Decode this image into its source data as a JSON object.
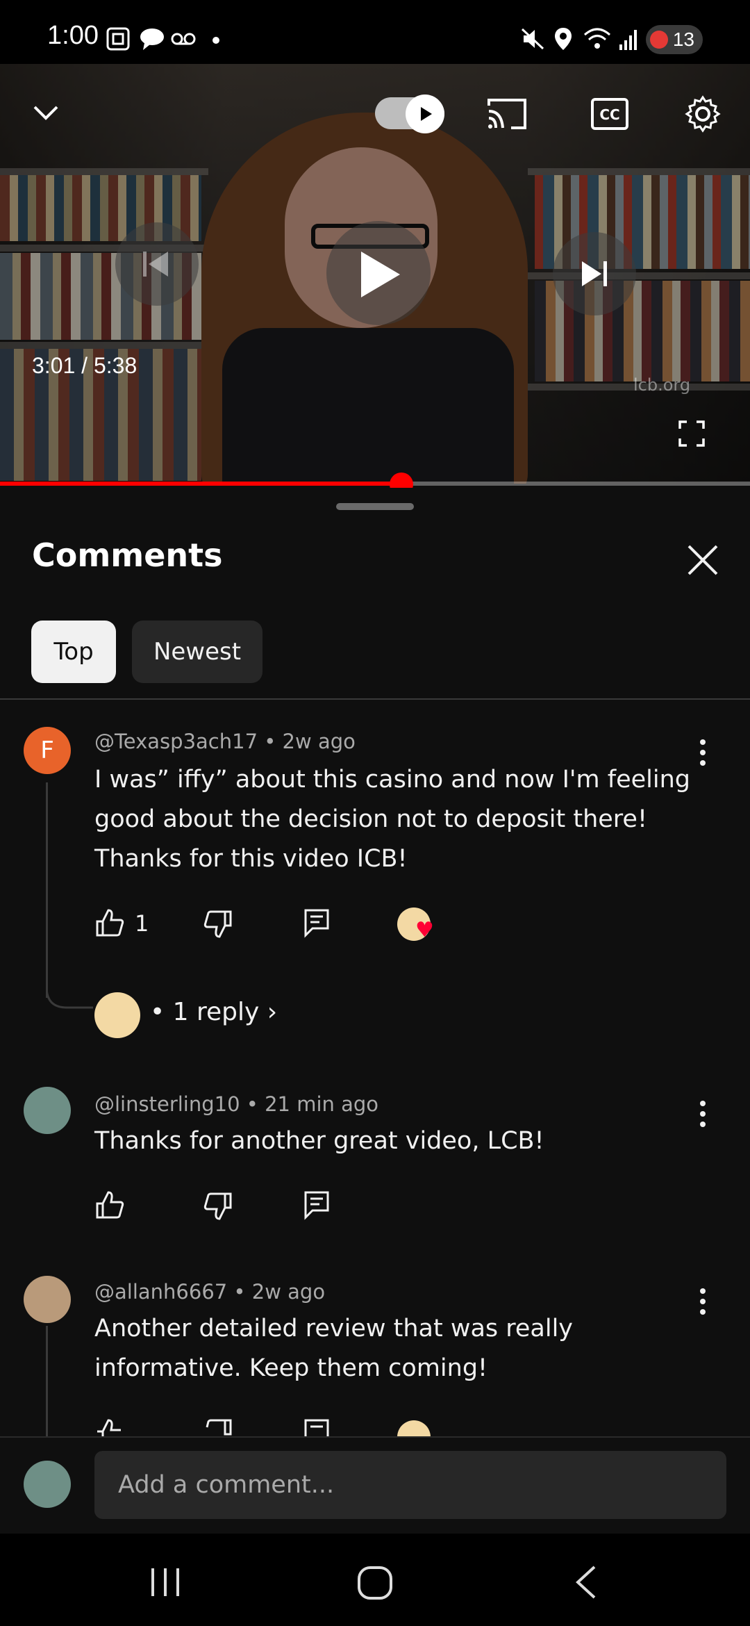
{
  "status_bar": {
    "time": "1:00",
    "icons": [
      "screenshot-icon",
      "message-icon",
      "voicemail-icon",
      "notification-dot-icon",
      "mute-icon",
      "location-icon",
      "wifi-icon",
      "signal-icon"
    ],
    "battery": "13"
  },
  "player": {
    "current_time": "3:01 / 5:38",
    "watermark": "lcb.org",
    "progress_fraction": 0.535
  },
  "panel": {
    "title": "Comments",
    "sort_options": [
      {
        "label": "Top",
        "selected": true
      },
      {
        "label": "Newest",
        "selected": false
      }
    ]
  },
  "comments": [
    {
      "avatar_letter": "F",
      "avatar_color": "#e8632a",
      "author_meta": "@Texasp3ach17 • 2w ago",
      "text": "I was” iffy” about this casino and now I'm feeling good about the decision not to deposit there! Thanks for this video ICB!",
      "likes": "1",
      "replies_label": "• 1 reply"
    },
    {
      "author_meta": "@linsterling10 • 21 min ago",
      "text": "Thanks for another great video, LCB!"
    },
    {
      "author_meta": "@allanh6667 • 2w ago",
      "text": "Another detailed review that was really informative. Keep them coming!"
    }
  ],
  "composer": {
    "placeholder": "Add a comment..."
  },
  "colors": {
    "accent": "#ff0000",
    "background": "#0f0f0f"
  }
}
